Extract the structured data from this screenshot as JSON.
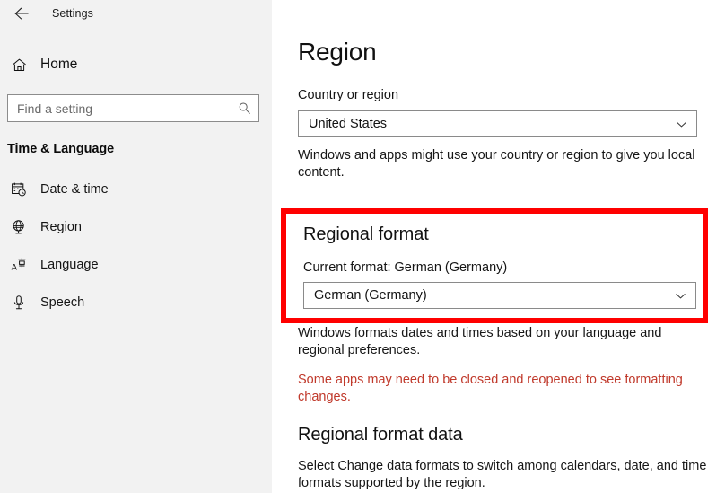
{
  "window": {
    "back_label": "back-arrow",
    "title": "Settings"
  },
  "sidebar": {
    "home_label": "Home",
    "search": {
      "placeholder": "Find a setting",
      "value": "",
      "icon": "search-icon"
    },
    "section_title": "Time & Language",
    "items": [
      {
        "label": "Date & time",
        "icon": "calendar-clock-icon"
      },
      {
        "label": "Region",
        "icon": "globe-icon"
      },
      {
        "label": "Language",
        "icon": "language-character-icon"
      },
      {
        "label": "Speech",
        "icon": "microphone-icon"
      }
    ]
  },
  "main": {
    "page_title": "Region",
    "country": {
      "label": "Country or region",
      "selected": "United States",
      "helper": "Windows and apps might use your country or region to give you local content."
    },
    "regional_format": {
      "heading": "Regional format",
      "current_format_label": "Current format: German (Germany)",
      "selected": "German (Germany)",
      "helper": "Windows formats dates and times based on your language and regional preferences.",
      "warning": "Some apps may need to be closed and reopened to see formatting changes."
    },
    "regional_format_data": {
      "heading": "Regional format data",
      "helper": "Select Change data formats to switch among calendars, date, and time formats supported by the region."
    }
  },
  "colors": {
    "highlight_border": "#ff0000",
    "warning_text": "#c0392b",
    "sidebar_bg": "#f2f2f2",
    "main_bg": "#ffffff"
  }
}
